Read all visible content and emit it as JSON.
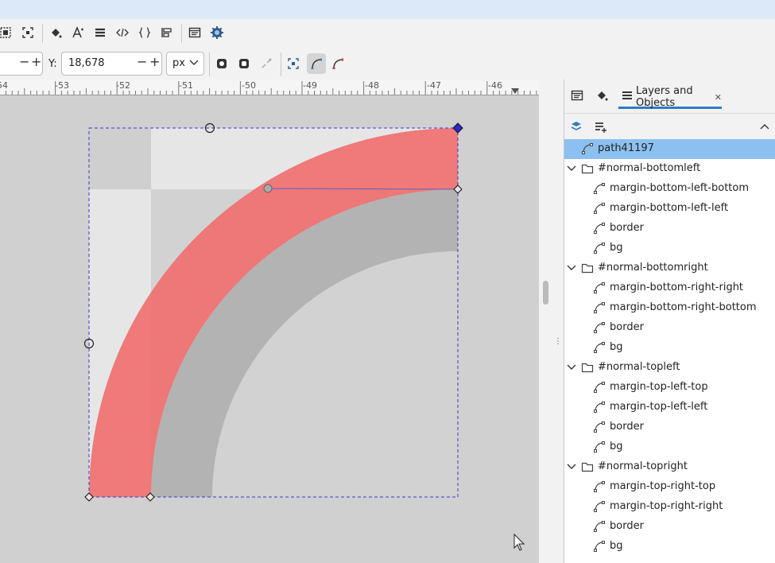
{
  "toolbar_icons": [
    "select-all-icon",
    "select-same-icon",
    "fill-stroke-icon",
    "text-font-icon",
    "layers-icon",
    "xml-editor-icon",
    "css-selectors-icon",
    "align-distribute-icon",
    "document-properties-icon",
    "preferences-icon"
  ],
  "tool_controls": {
    "x_value": "",
    "y_label": "Y:",
    "y_value": "18,678",
    "unit": "px",
    "minus": "−",
    "plus": "+"
  },
  "ruler": {
    "labels": [
      "-54",
      "-53",
      "-52",
      "-51",
      "-50",
      "-49",
      "-48",
      "-47",
      "-46"
    ]
  },
  "panel": {
    "tab_title": "Layers and Objects",
    "close_glyph": "✕"
  },
  "tree": [
    {
      "label": "path41197",
      "type": "path",
      "level": 1,
      "selected": true
    },
    {
      "label": "#normal-bottomleft",
      "type": "group",
      "level": 0,
      "expanded": true
    },
    {
      "label": "margin-bottom-left-bottom",
      "type": "path",
      "level": 1
    },
    {
      "label": "margin-bottom-left-left",
      "type": "path",
      "level": 1
    },
    {
      "label": "border",
      "type": "path",
      "level": 1
    },
    {
      "label": "bg",
      "type": "path",
      "level": 1
    },
    {
      "label": "#normal-bottomright",
      "type": "group",
      "level": 0,
      "expanded": true
    },
    {
      "label": "margin-bottom-right-right",
      "type": "path",
      "level": 1
    },
    {
      "label": "margin-bottom-right-bottom",
      "type": "path",
      "level": 1
    },
    {
      "label": "border",
      "type": "path",
      "level": 1
    },
    {
      "label": "bg",
      "type": "path",
      "level": 1
    },
    {
      "label": "#normal-topleft",
      "type": "group",
      "level": 0,
      "expanded": true
    },
    {
      "label": "margin-top-left-top",
      "type": "path",
      "level": 1
    },
    {
      "label": "margin-top-left-left",
      "type": "path",
      "level": 1
    },
    {
      "label": "border",
      "type": "path",
      "level": 1
    },
    {
      "label": "bg",
      "type": "path",
      "level": 1
    },
    {
      "label": "#normal-topright",
      "type": "group",
      "level": 0,
      "expanded": true
    },
    {
      "label": "margin-top-right-top",
      "type": "path",
      "level": 1
    },
    {
      "label": "margin-top-right-right",
      "type": "path",
      "level": 1
    },
    {
      "label": "border",
      "type": "path",
      "level": 1
    },
    {
      "label": "bg",
      "type": "path",
      "level": 1
    }
  ],
  "colors": {
    "accent": "#2d7cc4",
    "selection_row": "#8cc0f0",
    "shape_fill": "#f07070",
    "canvas_bg": "#d0d0d0"
  }
}
